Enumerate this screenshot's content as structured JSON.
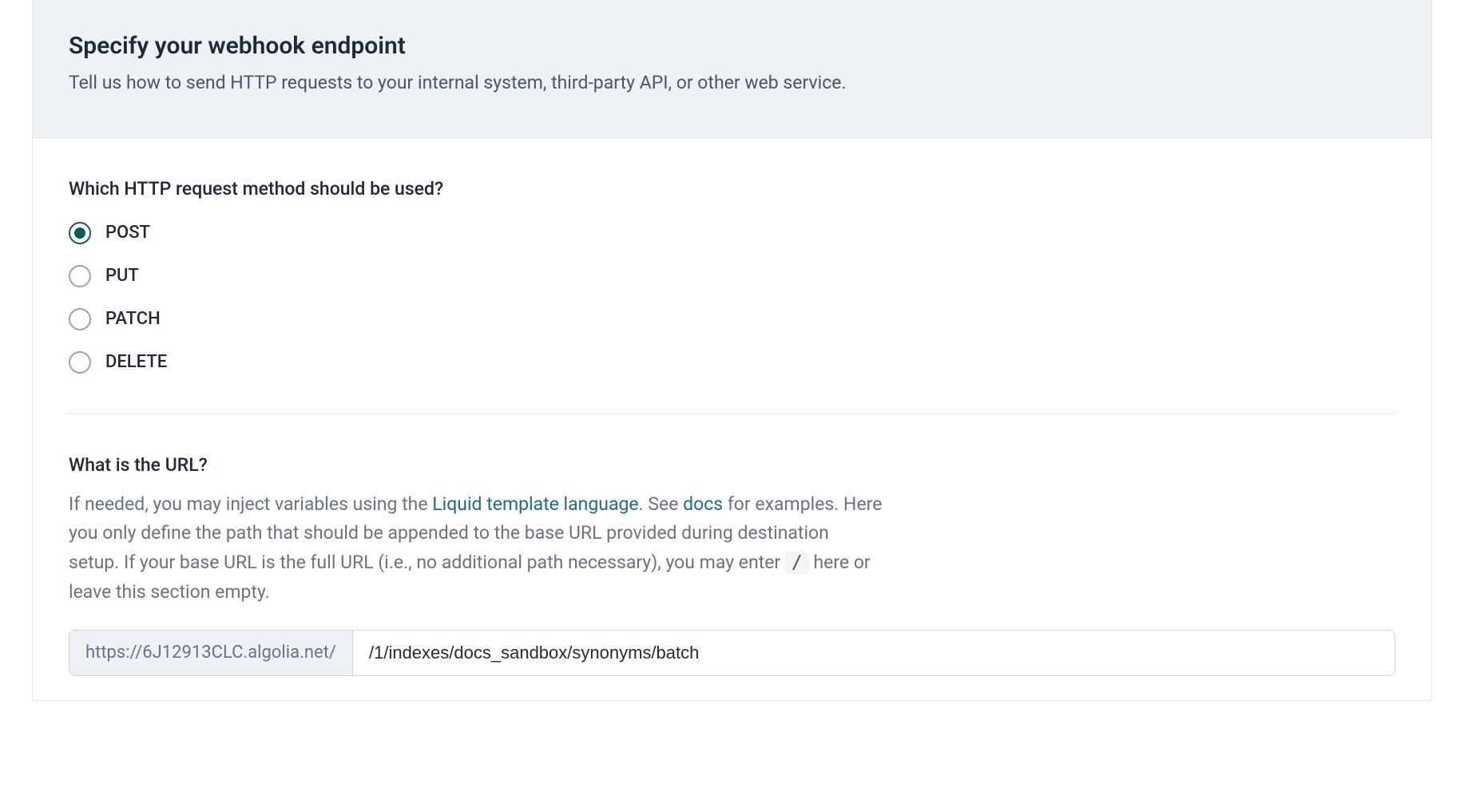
{
  "header": {
    "title": "Specify your webhook endpoint",
    "description": "Tell us how to send HTTP requests to your internal system, third-party API, or other web service."
  },
  "http_method": {
    "question": "Which HTTP request method should be used?",
    "options": [
      {
        "label": "POST",
        "selected": true
      },
      {
        "label": "PUT",
        "selected": false
      },
      {
        "label": "PATCH",
        "selected": false
      },
      {
        "label": "DELETE",
        "selected": false
      }
    ]
  },
  "url_section": {
    "question": "What is the URL?",
    "desc_part1": "If needed, you may inject variables using the ",
    "link1": "Liquid template language",
    "desc_part2": ". See ",
    "link2": "docs",
    "desc_part3": " for examples. Here you only define the path that should be appended to the base URL provided during destination setup. If your base URL is the full URL (i.e., no additional path necessary), you may enter ",
    "slash": "/",
    "desc_part4": " here or leave this section empty.",
    "prefix": "https://6J12913CLC.algolia.net/",
    "value": "/1/indexes/docs_sandbox/synonyms/batch"
  }
}
